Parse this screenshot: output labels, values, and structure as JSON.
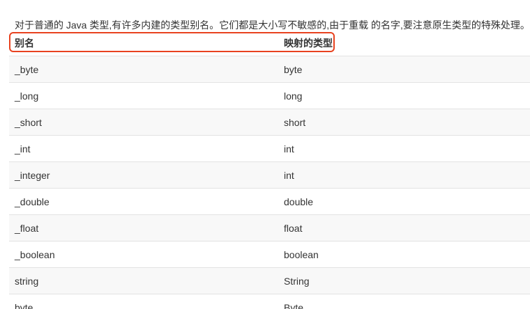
{
  "intro": "对于普通的 Java 类型,有许多内建的类型别名。它们都是大小写不敏感的,由于重载 的名字,要注意原生类型的特殊处理。",
  "table": {
    "headers": [
      "别名",
      "映射的类型"
    ],
    "rows": [
      [
        "_byte",
        "byte"
      ],
      [
        "_long",
        "long"
      ],
      [
        "_short",
        "short"
      ],
      [
        "_int",
        "int"
      ],
      [
        "_integer",
        "int"
      ],
      [
        "_double",
        "double"
      ],
      [
        "_float",
        "float"
      ],
      [
        "_boolean",
        "boolean"
      ],
      [
        "string",
        "String"
      ],
      [
        "byte",
        "Byte"
      ]
    ]
  },
  "colors": {
    "highlight": "#e8421f",
    "stripe": "#f8f8f8",
    "divider": "#e3e3e3",
    "text": "#333333"
  }
}
